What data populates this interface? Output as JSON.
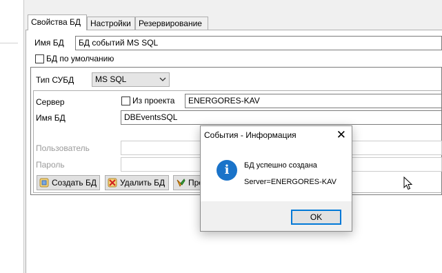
{
  "tabs": [
    {
      "label": "Свойства БД",
      "active": true
    },
    {
      "label": "Настройки",
      "active": false
    },
    {
      "label": "Резервирование",
      "active": false
    }
  ],
  "form": {
    "db_name_label": "Имя БД",
    "db_name_value": "БД событий MS SQL",
    "default_db_label": "БД по умолчанию",
    "dbms_type_label": "Тип СУБД",
    "dbms_type_value": "MS SQL",
    "server_label": "Сервер",
    "from_project_label": "Из проекта",
    "server_value": "ENERGORES-KAV",
    "inner_db_name_label": "Имя БД",
    "inner_db_name_value": "DBEventsSQL",
    "user_label": "Пользователь",
    "user_value": "",
    "password_label": "Пароль",
    "password_value": ""
  },
  "buttons": {
    "create_label": "Создать БД",
    "delete_label": "Удалить БД",
    "check_label": "Про"
  },
  "dialog": {
    "title": "События - Информация",
    "close_glyph": "✕",
    "icon_glyph": "i",
    "message_line1": "БД успешно создана",
    "message_line2": "Server=ENERGORES-KAV",
    "ok_label": "OK"
  },
  "icons": {
    "combo_arrow": "chevron-down-icon",
    "info": "info-icon",
    "close": "close-icon",
    "create": "database-create-icon",
    "delete": "database-delete-icon",
    "check": "connection-check-icon"
  },
  "colors": {
    "info_icon": "#1a73c9",
    "ok_border": "#0078d7"
  }
}
